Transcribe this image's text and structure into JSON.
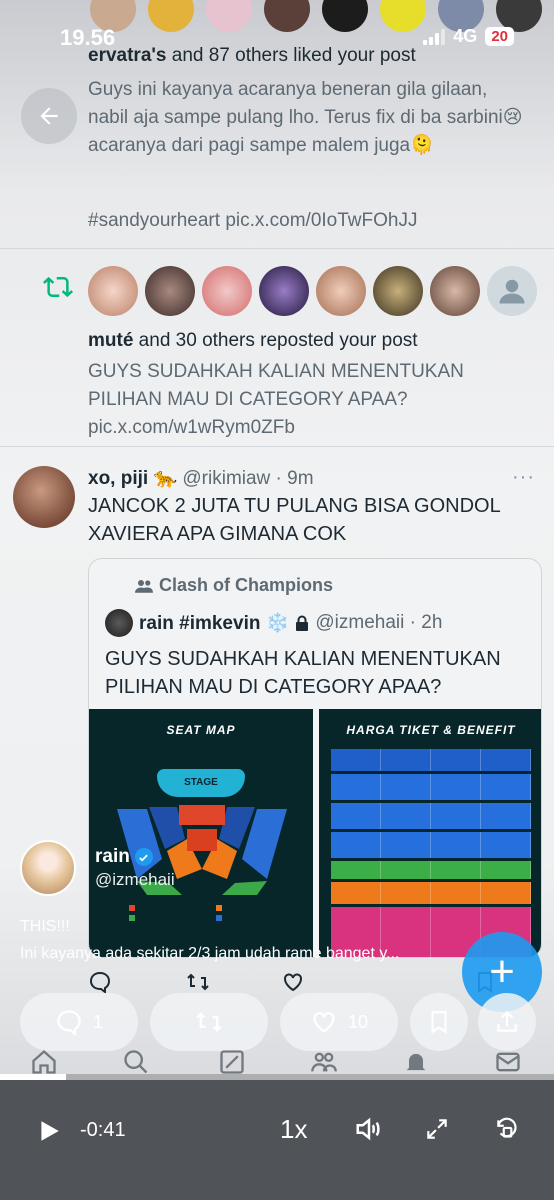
{
  "status_bar": {
    "time": "19.56",
    "network": "4G",
    "battery": "20"
  },
  "liked_notification": {
    "user": "ervatra's",
    "text": " and 87 others liked your post"
  },
  "liked_post": {
    "text": "Guys ini kayanya acaranya beneran gila gilaan, nabil aja sampe pulang lho. Terus fix di ba sarbini😢 acaranya dari pagi sampe malem juga🫠",
    "hashtag_line": "#sandyourheart pic.x.com/0IoTwFOhJJ"
  },
  "repost_notification": {
    "user": "muté",
    "text": " and 30 others reposted your post"
  },
  "reposted_post": {
    "text": "GUYS SUDAHKAH KALIAN MENENTUKAN PILIHAN MAU DI CATEGORY APAA? pic.x.com/w1wRym0ZFb"
  },
  "reply_tweet": {
    "name": "xo, piji 🐆",
    "handle_time": " @rikimiaw · 9m",
    "text": "JANCOK 2 JUTA TU PULANG BISA GONDOL XAVIERA APA GIMANA COK"
  },
  "quoted_tweet": {
    "community": "Clash of Champions",
    "name": "rain #imkevin ❄️",
    "handle_time": "@izmehaii · 2h",
    "text": "GUYS SUDAHKAH KALIAN MENENTUKAN PILIHAN MAU DI CATEGORY APAA?",
    "media": [
      {
        "title": "SEAT MAP",
        "stage": "STAGE"
      },
      {
        "title": "HARGA TIKET & BENEFIT"
      }
    ]
  },
  "main_tweet": {
    "name": "rain",
    "handle": "@izmehaii",
    "caption_line1": "THIS!!!",
    "caption_line2": "Ini kayanya ada sekitar 2/3 jam udah rame banget y..."
  },
  "actions": {
    "replies": "1",
    "likes": "10"
  },
  "player": {
    "time_remaining": "-0:41",
    "speed": "1x",
    "progress": 0.12
  },
  "colors": {
    "accent": "#1d9bf0",
    "repost_green": "#00ba7c",
    "player_bg": "#505357"
  }
}
